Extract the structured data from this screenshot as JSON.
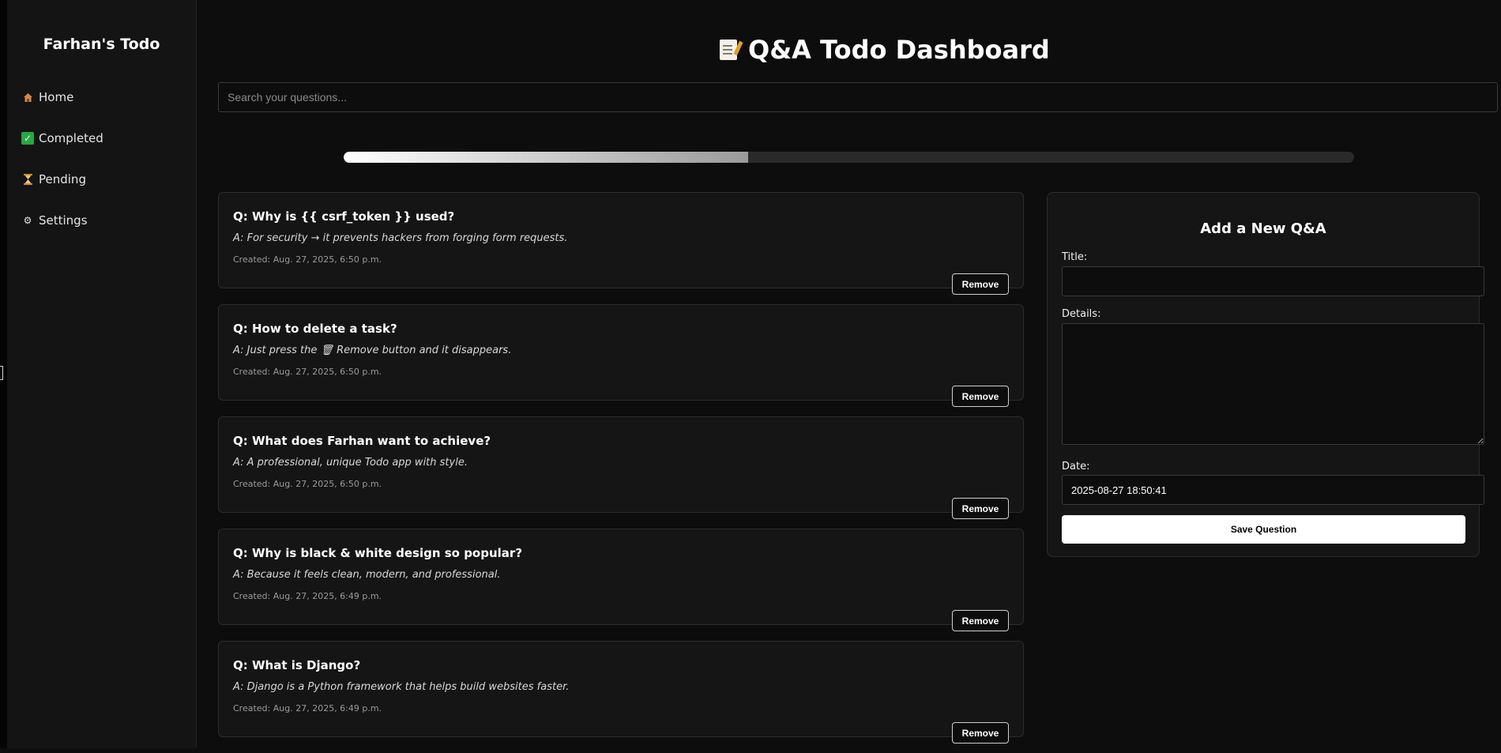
{
  "sidebar": {
    "brand": "Farhan's Todo",
    "items": [
      {
        "label": "Home",
        "icon": "home-icon"
      },
      {
        "label": "Completed",
        "icon": "check-box-icon"
      },
      {
        "label": "Pending",
        "icon": "hourglass-icon"
      },
      {
        "label": "Settings",
        "icon": "gear-icon"
      }
    ]
  },
  "header": {
    "title": "Q&A Todo Dashboard",
    "icon": "memo-icon"
  },
  "search": {
    "placeholder": "Search your questions..."
  },
  "progress": {
    "fraction": 0.4
  },
  "questions": [
    {
      "q": "Q: Why is {{ csrf_token }} used?",
      "a": "A: For security → it prevents hackers from forging form requests.",
      "created": "Created: Aug. 27, 2025, 6:50 p.m.",
      "remove_label": "Remove"
    },
    {
      "q": "Q: How to delete a task?",
      "a": "A: Just press the 🗑 Remove button and it disappears.",
      "created": "Created: Aug. 27, 2025, 6:50 p.m.",
      "remove_label": "Remove"
    },
    {
      "q": "Q: What does Farhan want to achieve?",
      "a": "A: A professional, unique Todo app with style.",
      "created": "Created: Aug. 27, 2025, 6:50 p.m.",
      "remove_label": "Remove"
    },
    {
      "q": "Q: Why is black & white design so popular?",
      "a": "A: Because it feels clean, modern, and professional.",
      "created": "Created: Aug. 27, 2025, 6:49 p.m.",
      "remove_label": "Remove"
    },
    {
      "q": "Q: What is Django?",
      "a": "A: Django is a Python framework that helps build websites faster.",
      "created": "Created: Aug. 27, 2025, 6:49 p.m.",
      "remove_label": "Remove"
    }
  ],
  "form": {
    "title": "Add a New Q&A",
    "title_label": "Title:",
    "title_value": "",
    "details_label": "Details:",
    "details_value": "",
    "date_label": "Date:",
    "date_value": "2025-08-27 18:50:41",
    "save_label": "Save Question"
  },
  "colors": {
    "background": "#0d0d0d",
    "panel": "#151515",
    "accent": "#ffffff"
  }
}
